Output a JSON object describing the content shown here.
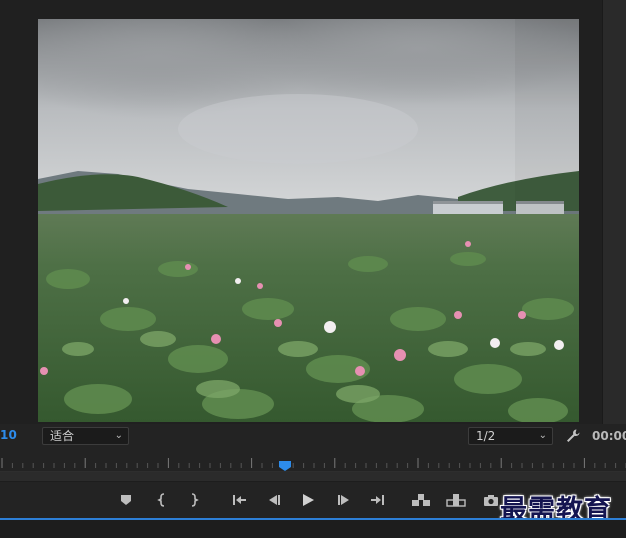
{
  "monitor": {
    "timecode_left": "10",
    "fit_select": {
      "value": "适合"
    },
    "resolution_select": {
      "value": "1/2"
    },
    "timecode_right": "00:00",
    "playhead": {
      "position_fraction": 0.455
    }
  },
  "transport": {
    "buttons": [
      {
        "name": "add-marker-button",
        "icon": "marker-icon"
      },
      {
        "name": "mark-in-button",
        "icon": "mark-in-icon"
      },
      {
        "name": "mark-out-button",
        "icon": "mark-out-icon"
      },
      {
        "name": "go-to-in-button",
        "icon": "go-to-in-icon"
      },
      {
        "name": "step-back-button",
        "icon": "step-back-icon"
      },
      {
        "name": "play-button",
        "icon": "play-icon"
      },
      {
        "name": "step-forward-button",
        "icon": "step-forward-icon"
      },
      {
        "name": "go-to-out-button",
        "icon": "go-to-out-icon"
      },
      {
        "name": "insert-button",
        "icon": "insert-icon"
      },
      {
        "name": "overwrite-button",
        "icon": "overwrite-icon"
      },
      {
        "name": "export-frame-button",
        "icon": "camera-icon"
      }
    ]
  },
  "watermark": {
    "text": "最需教育"
  },
  "colors": {
    "accent": "#2d8ceb",
    "panel_bg": "#232323",
    "watermark": "#141450"
  }
}
